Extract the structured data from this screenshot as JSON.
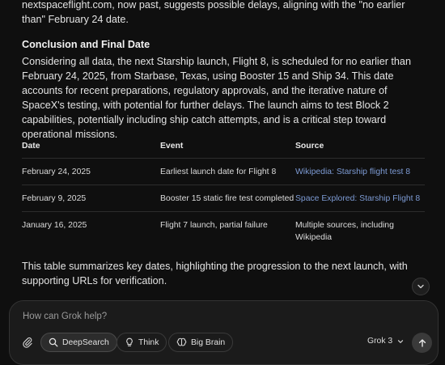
{
  "response": {
    "intro_text": "nextspaceflight.com, now past, suggests possible delays, aligning with the \"no earlier than\" February 24 date.",
    "conclusion_heading": "Conclusion and Final Date",
    "conclusion_text": "Considering all data, the next Starship launch, Flight 8, is scheduled for no earlier than February 24, 2025, from Starbase, Texas, using Booster 15 and Ship 34. This date accounts for recent preparations, regulatory approvals, and the iterative nature of SpaceX's testing, with potential for further delays. The launch aims to test Block 2 capabilities, potentially including ship catch attempts, and is a critical step toward operational missions.",
    "table": {
      "headers": [
        "Date",
        "Event",
        "Source"
      ],
      "rows": [
        {
          "date": "February 24, 2025",
          "event": "Earliest launch date for Flight 8",
          "source": "Wikipedia: Starship flight test 8",
          "source_is_link": true
        },
        {
          "date": "February 9, 2025",
          "event": "Booster 15 static fire test completed",
          "source": "Space Explored: Starship Flight 8",
          "source_is_link": true
        },
        {
          "date": "January 16, 2025",
          "event": "Flight 7 launch, partial failure",
          "source": "Multiple sources, including Wikipedia",
          "source_is_link": false
        }
      ]
    },
    "summary_text": "This table summarizes key dates, highlighting the progression to the next launch, with supporting URLs for verification."
  },
  "composer": {
    "placeholder": "How can Grok help?",
    "deepsearch_label": "DeepSearch",
    "think_label": "Think",
    "bigbrain_label": "Big Brain",
    "model_label": "Grok 3"
  },
  "colors": {
    "background": "#0f0f0f",
    "link": "#7d9bd4",
    "composer_bg": "#1b1b1b"
  },
  "icons": [
    "chevron-down-icon",
    "paperclip-icon",
    "search-icon",
    "lightbulb-icon",
    "brain-icon",
    "arrow-up-icon"
  ]
}
